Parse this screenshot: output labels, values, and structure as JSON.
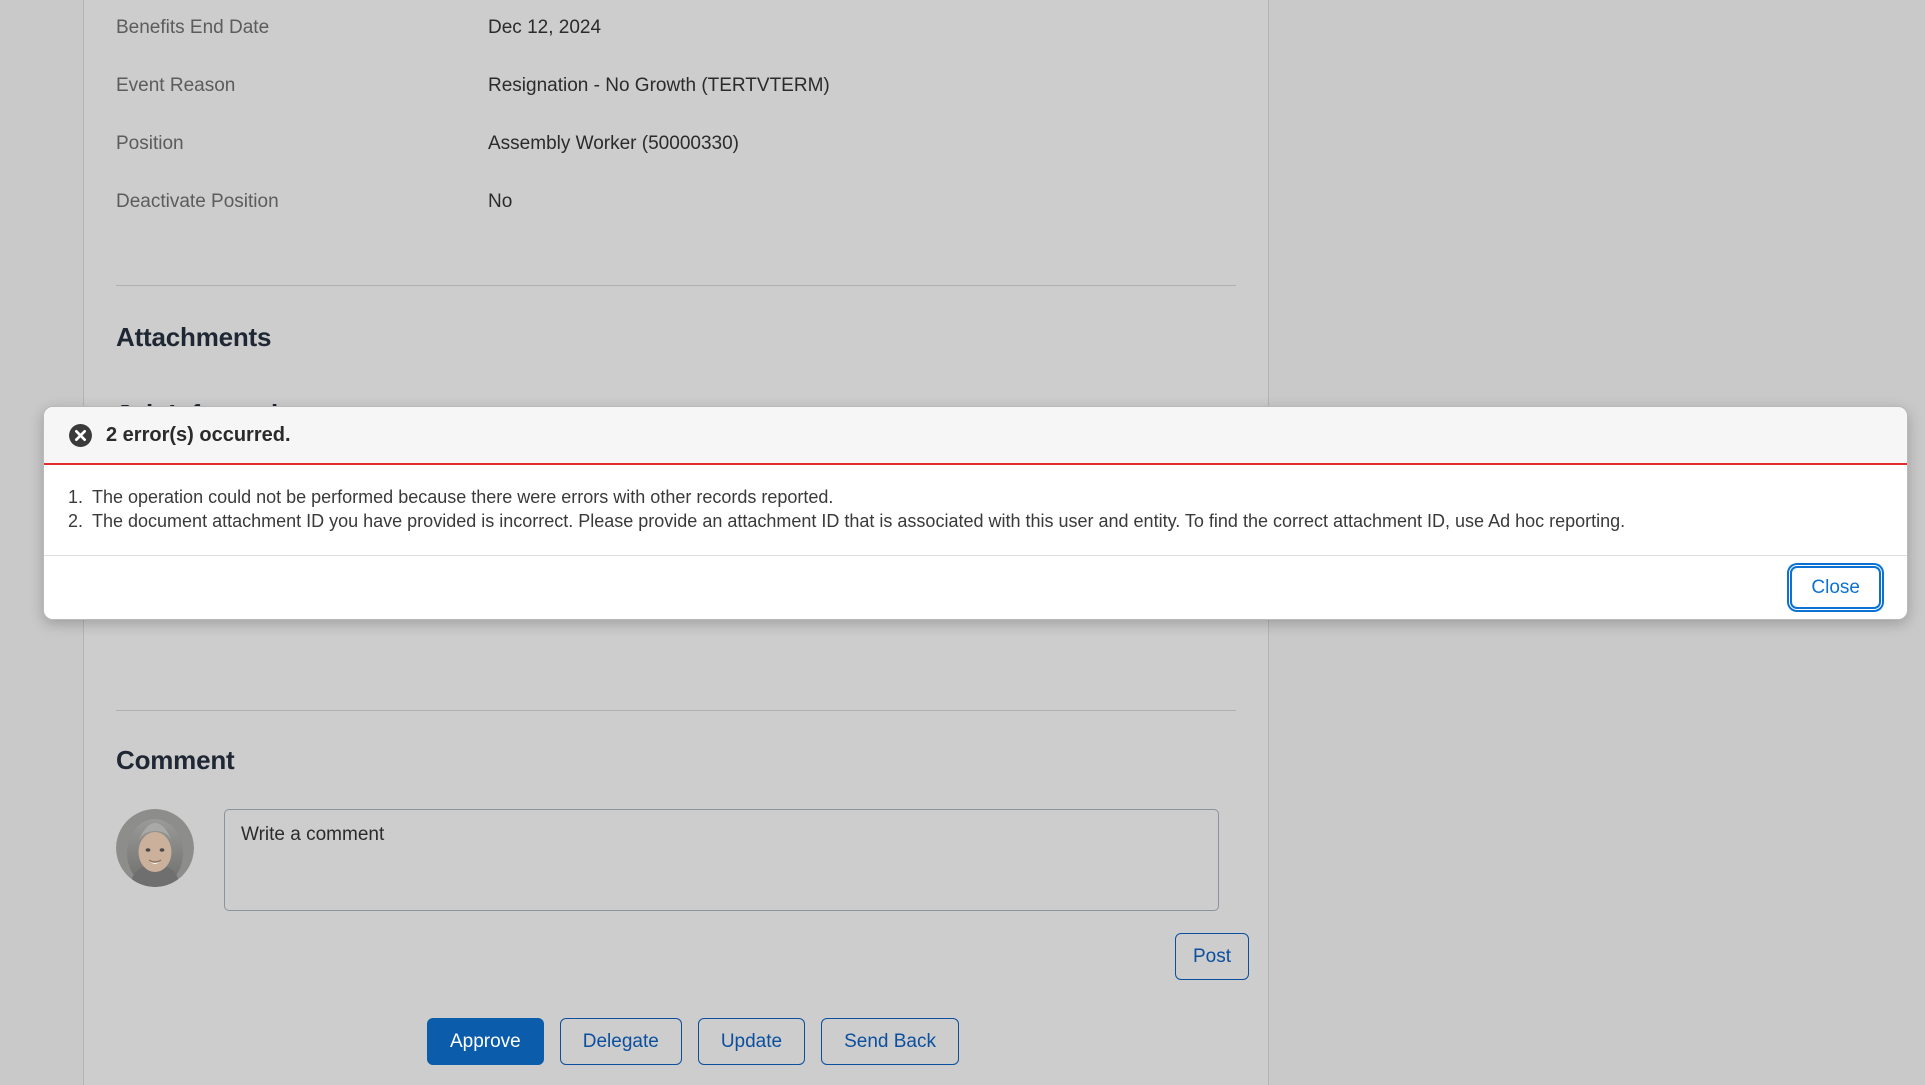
{
  "details": {
    "fields": [
      {
        "label": "Benefits End Date",
        "value": "Dec 12, 2024"
      },
      {
        "label": "Event Reason",
        "value": "Resignation - No Growth (TERTVTERM)"
      },
      {
        "label": "Position",
        "value": "Assembly Worker (50000330)"
      },
      {
        "label": "Deactivate Position",
        "value": "No"
      }
    ]
  },
  "attachments": {
    "title": "Attachments"
  },
  "job_information": {
    "title": "Job Information"
  },
  "comment": {
    "title": "Comment",
    "textarea_value": "Write a comment",
    "post_label": "Post"
  },
  "actions": {
    "approve": "Approve",
    "delegate": "Delegate",
    "update": "Update",
    "send_back": "Send Back"
  },
  "error_dialog": {
    "icon": "error-circle-x-icon",
    "title": "2 error(s) occurred.",
    "accent_color": "#e32b2b",
    "messages": [
      {
        "num": "1.",
        "text": "The operation could not be performed because there were errors with other records reported."
      },
      {
        "num": "2.",
        "text": "The document attachment ID you have provided is incorrect. Please provide an attachment ID that is associated with this user and entity. To find the correct attachment ID, use Ad hoc reporting."
      }
    ],
    "close_label": "Close"
  },
  "theme": {
    "primary_blue": "#0b5cab",
    "link_blue": "#0b4f9e",
    "focus_blue": "#0b72d4",
    "page_bg": "#c9c9c9",
    "card_bg": "#cdcdcd"
  }
}
